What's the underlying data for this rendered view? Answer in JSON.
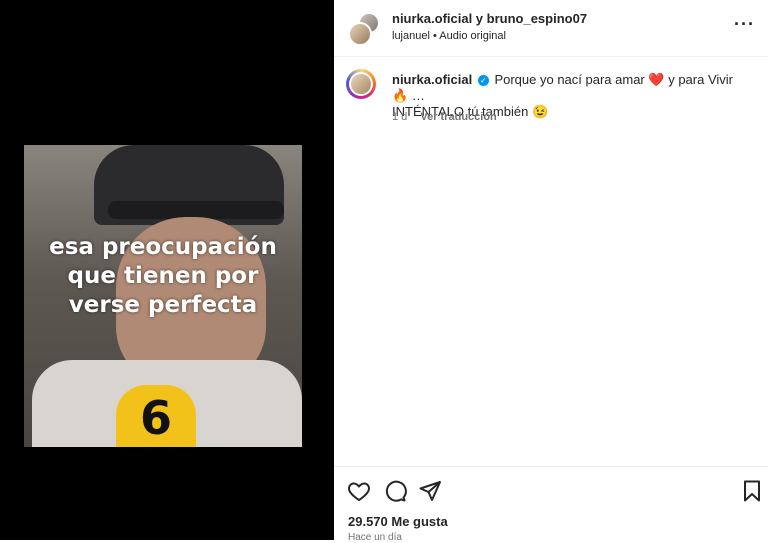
{
  "post": {
    "header_title": "niurka.oficial y bruno_espino07",
    "header_audio_user": "lujanuel",
    "header_audio_sep": "•",
    "header_audio": "Audio original",
    "more_glyph": "···"
  },
  "video": {
    "overlay_lines": [
      "esa preocupación",
      "que tienen por",
      "verse perfecta"
    ],
    "mic_label": "6"
  },
  "caption": {
    "username": "niurka.oficial",
    "verified_glyph": "✓",
    "text_a": "Porque yo nací para amar",
    "heart_emoji": "❤️",
    "text_b": "y para Vivir",
    "fire_emoji": "🔥",
    "ellipsis": "…",
    "text_c": "INTÉNTALO tú también",
    "wink_emoji": "😉",
    "time": "1 d",
    "translate": "Ver traducción"
  },
  "actions": {
    "like_icon": "heart-outline-icon",
    "comment_icon": "comment-bubble-icon",
    "share_icon": "paper-plane-icon",
    "save_icon": "bookmark-icon"
  },
  "stats": {
    "likes": "29.570 Me gusta",
    "posted": "Hace un día"
  },
  "colors": {
    "link_blue": "#0095f6",
    "muted": "#737373",
    "text": "#262626"
  }
}
